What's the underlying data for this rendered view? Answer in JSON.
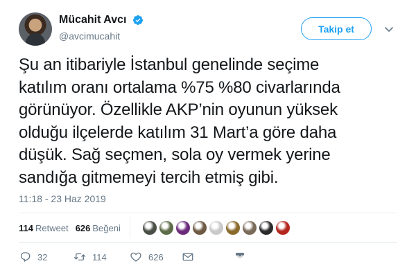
{
  "user": {
    "display_name": "Mücahit Avcı",
    "handle": "@avcimucahit",
    "verified_icon": "verified-badge-icon",
    "avatar_icon": "avatar"
  },
  "header": {
    "follow_label": "Takip et",
    "menu_icon": "chevron-down-icon"
  },
  "tweet": {
    "lines": [
      "Şu an itibariyle İstanbul genelinde seçime",
      "katılım oranı ortalama %75 %80 civarlarında",
      "görünüyor. Özellikle AKP’nin oyunun yüksek",
      "olduğu ilçelerde katılım 31 Mart’a göre daha",
      "düşük. Sağ seçmen, sola oy vermek yerine",
      "sandığa gitmemeyi tercih etmiş gibi."
    ],
    "timestamp": "11:18 - 23 Haz 2019"
  },
  "stats": {
    "retweets_count": "114",
    "retweets_label": "Retweet",
    "likes_count": "626",
    "likes_label": "Beğeni"
  },
  "likers": {
    "colors": [
      "#4a4f46",
      "#5d6b48",
      "#6b2a7a",
      "#6e5a44",
      "#c9c9c9",
      "#8a6a2a",
      "#7a6a5a",
      "#2b2b2b",
      "#b3261e"
    ]
  },
  "actions": {
    "reply_count": "32",
    "retweet_count": "114",
    "like_count": "626"
  },
  "colors": {
    "accent": "#1da1f2",
    "text": "#14171a",
    "muted": "#657786",
    "divider": "#e6ecf0"
  }
}
